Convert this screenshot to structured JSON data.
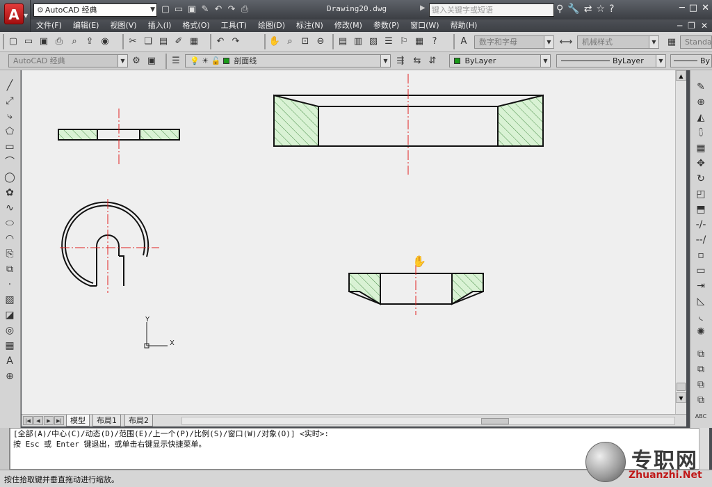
{
  "titlebar": {
    "workspace": "AutoCAD 经典",
    "document": "Drawing20.dwg",
    "search_placeholder": "键入关键字或短语"
  },
  "menu": [
    "文件(F)",
    "编辑(E)",
    "视图(V)",
    "插入(I)",
    "格式(O)",
    "工具(T)",
    "绘图(D)",
    "标注(N)",
    "修改(M)",
    "参数(P)",
    "窗口(W)",
    "帮助(H)"
  ],
  "toolbar1": {
    "text_style": "数字和字母",
    "dim_style": "机械样式",
    "table_style": "Standa"
  },
  "toolbar2": {
    "workspace": "AutoCAD 经典",
    "layer": "剖面线",
    "color": "ByLayer",
    "linetype": "ByLayer",
    "lineweight": "By",
    "layer_color": "#1a9a1a"
  },
  "ucs": {
    "x_label": "X",
    "y_label": "Y"
  },
  "tabs": [
    "模型",
    "布局1",
    "布局2"
  ],
  "command": {
    "line1": "[全部(A)/中心(C)/动态(D)/范围(E)/上一个(P)/比例(S)/窗口(W)/对象(O)] <实时>:",
    "line2": "按 Esc 或 Enter 键退出，或单击右键显示快捷菜单。"
  },
  "status_text": "按住拾取键并垂直拖动进行缩放。",
  "watermark": {
    "cn": "专职网",
    "en": "Zhuanzhi.Net"
  },
  "colors": {
    "hatch_fill": "#d9f2d4",
    "hatch_line": "#2a7a2a",
    "center_line": "#e02020"
  }
}
